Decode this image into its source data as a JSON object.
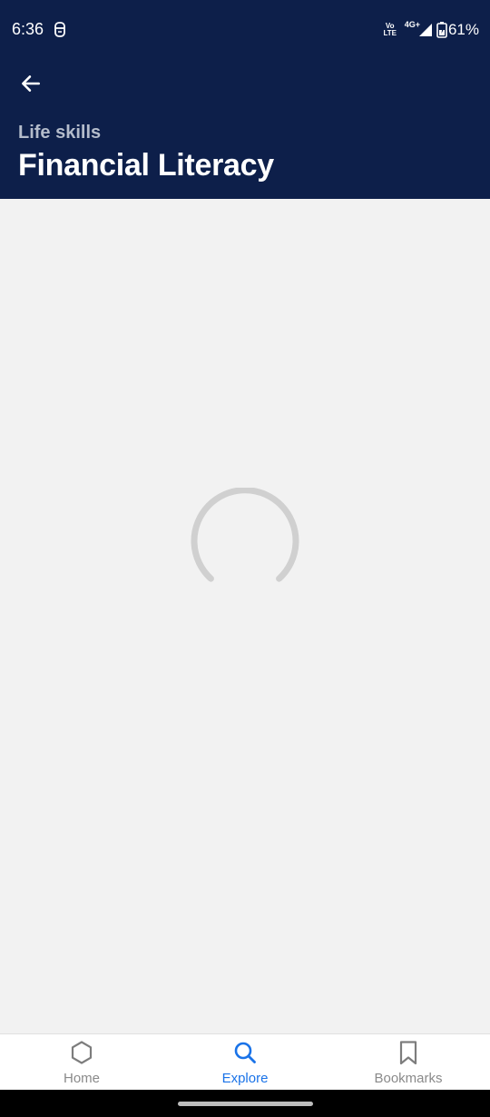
{
  "status_bar": {
    "time": "6:36",
    "volte_line1": "Vo",
    "volte_line2": "LTE",
    "network": "4G+",
    "battery": "61%",
    "icons": [
      "notification-icon",
      "volte-icon",
      "signal-icon",
      "battery-icon"
    ]
  },
  "header": {
    "back_icon": "back-arrow-icon",
    "subtitle": "Life skills",
    "title": "Financial Literacy"
  },
  "content": {
    "state": "loading",
    "spinner_icon": "loading-spinner-icon"
  },
  "bottom_nav": {
    "items": [
      {
        "label": "Home",
        "icon": "home-hexagon-icon",
        "active": false
      },
      {
        "label": "Explore",
        "icon": "search-icon",
        "active": true
      },
      {
        "label": "Bookmarks",
        "icon": "bookmark-icon",
        "active": false
      }
    ]
  },
  "colors": {
    "header_bg": "#0d1f4a",
    "page_bg": "#f2f2f2",
    "accent": "#1a73e8",
    "inactive": "#8a8a8a"
  }
}
